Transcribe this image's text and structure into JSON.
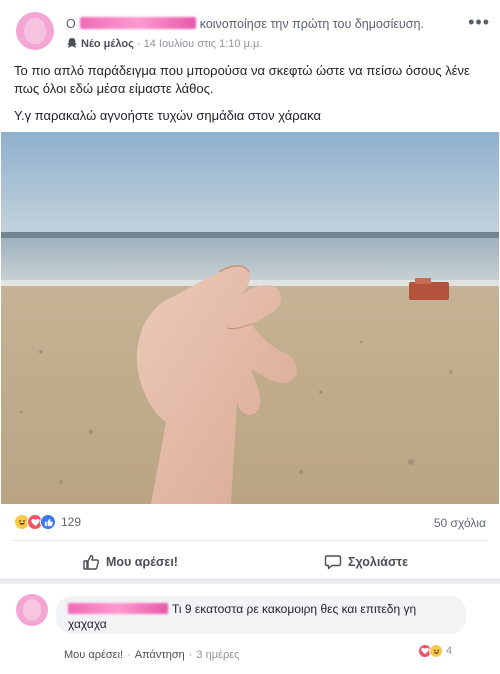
{
  "post": {
    "header": {
      "prefix": "Ο",
      "action": "κοινοποίησε την πρώτη του δημοσίευση.",
      "badge_label": "Νέο μέλος",
      "meta": "· 14 Ιουλίου στις 1:10 μ.μ."
    },
    "text": {
      "line1": "Το πιο απλό παράδειγμα που μπορούσα να σκεφτώ ώστε να πείσω όσους λένε πως όλοι εδώ μέσα είμαστε λάθος.",
      "line2": "Υ.γ παρακαλώ αγνοήστε τυχών σημάδια στον χάρακα"
    },
    "reactions": {
      "count": "129",
      "comments": "50 σχόλια"
    },
    "actions": {
      "like": "Μου αρέσει!",
      "comment": "Σχολιάστε"
    }
  },
  "comment": {
    "text": "Τι 9 εκατοστα ρε κακομοιρη θες και επιτεδη γη χαχαχα",
    "reaction_count": "4",
    "like": "Μου αρέσει!",
    "reply": "Απάντηση",
    "time": "3 ημέρες"
  },
  "colors": {
    "accent": "#4267b2",
    "redaction": "#f06bb7"
  }
}
